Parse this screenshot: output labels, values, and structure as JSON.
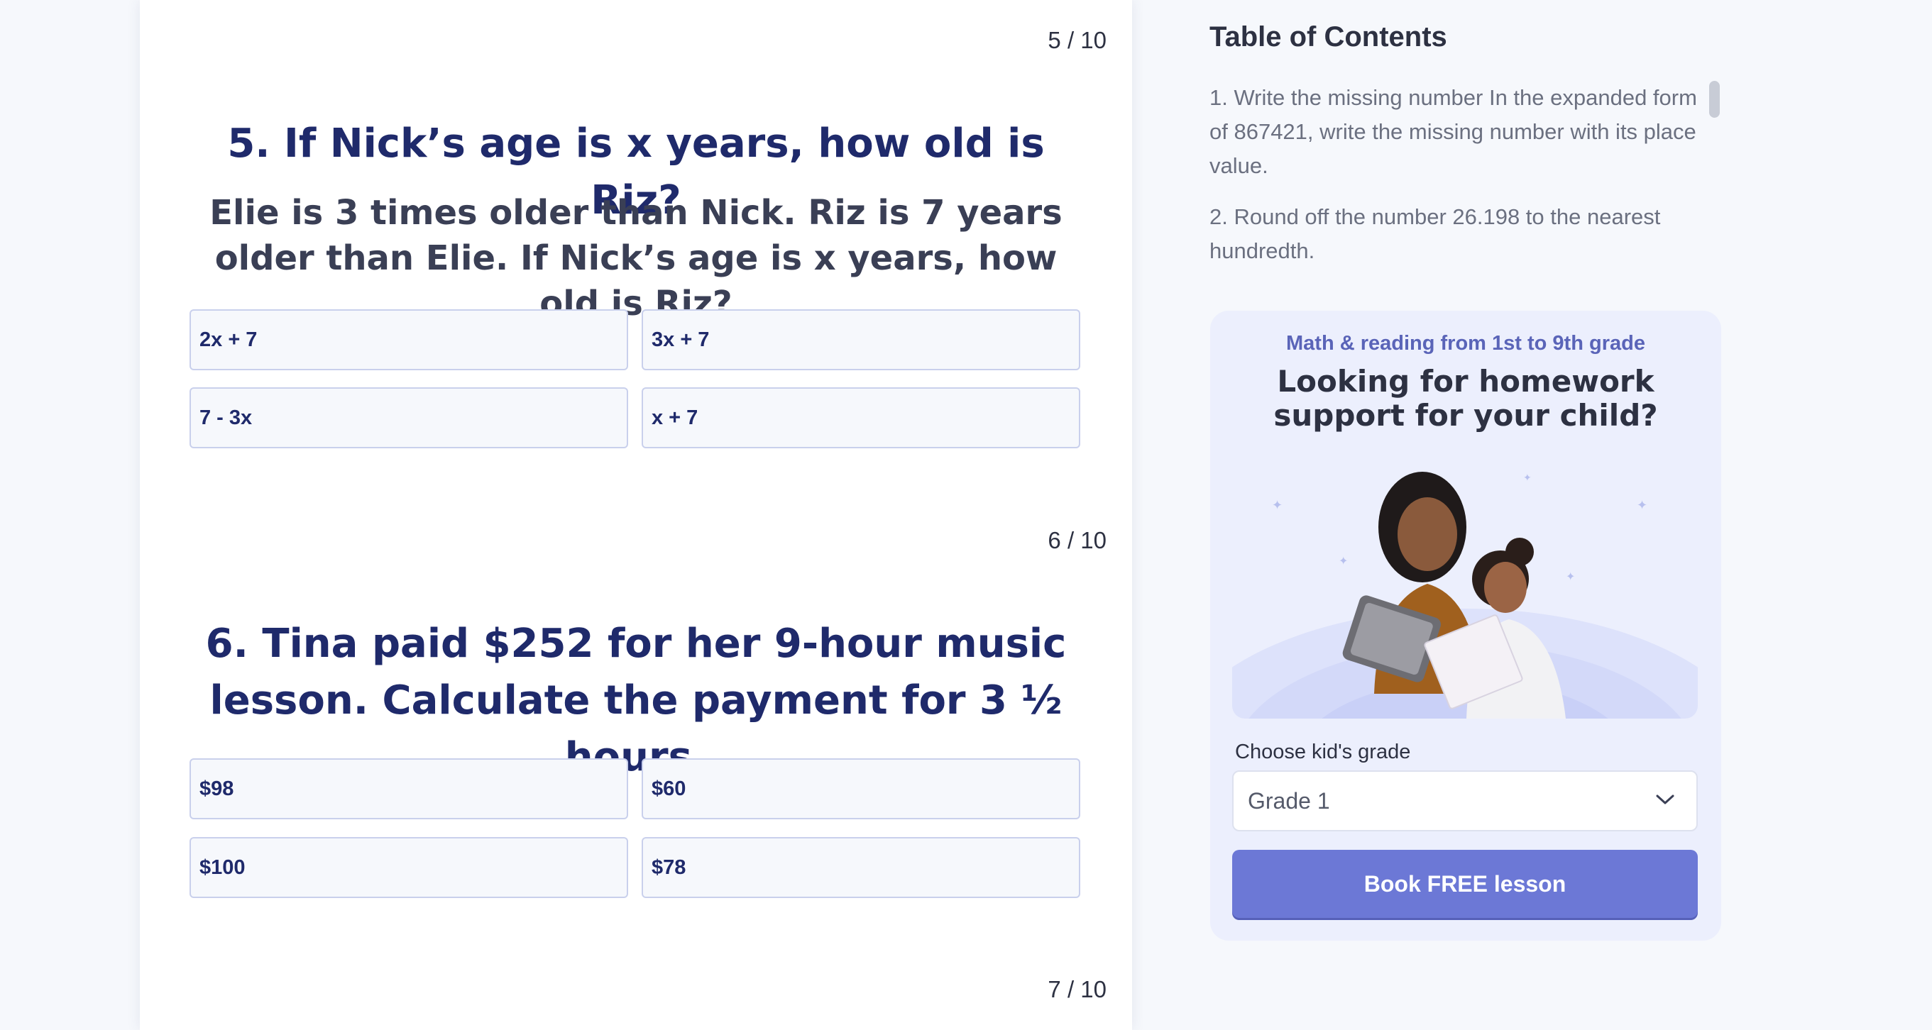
{
  "questions": [
    {
      "counter": "5 / 10",
      "title": "5. If Nick’s age is x years, how old is Riz?",
      "description": "Elie is 3 times older than Nick. Riz is 7 years older than Elie. If Nick’s age is x years, how old is Riz?",
      "options": [
        "2x + 7",
        "3x + 7",
        "7 - 3x",
        "x + 7"
      ]
    },
    {
      "counter": "6 / 10",
      "title": "6. Tina paid $252 for her 9-hour music lesson. Calculate the payment for 3 ½ hours.",
      "options": [
        "$98",
        "$60",
        "$100",
        "$78"
      ]
    },
    {
      "counter": "7 / 10"
    }
  ],
  "toc": {
    "title": "Table of Contents",
    "items": [
      "1. Write the missing number In the expanded form of 867421, write the missing number with its place value.",
      "2. Round off the number 26.198 to the nearest hundredth."
    ]
  },
  "promo": {
    "subtitle": "Math & reading from 1st to 9th grade",
    "title": "Looking for homework support for your child?",
    "grade_label": "Choose kid's grade",
    "grade_selected": "Grade 1",
    "button_label": "Book FREE lesson"
  },
  "colors": {
    "heading": "#1f2a6b",
    "accent_button": "#6c78d6",
    "promo_bg": "#eceffd"
  }
}
